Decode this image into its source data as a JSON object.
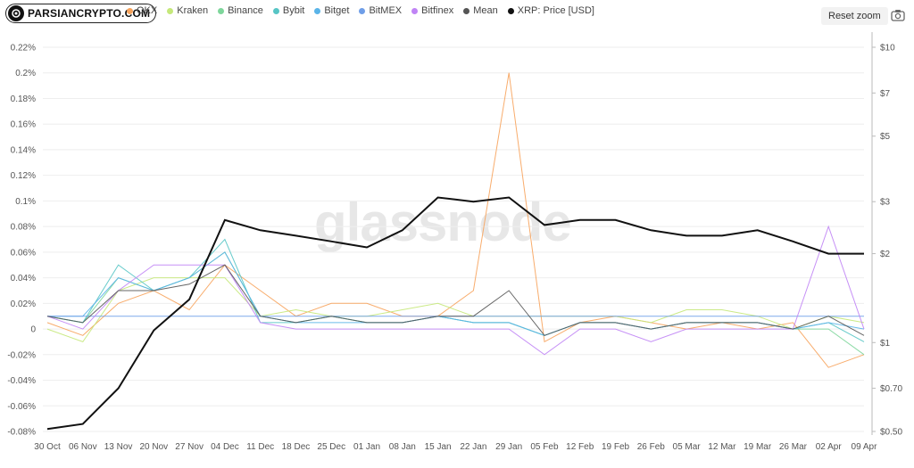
{
  "header": {
    "badge_text": "PARSIANCRYPTO.COM",
    "reset_zoom_label": "Reset zoom",
    "watermark": "glassnode"
  },
  "chart_data": {
    "type": "line",
    "left_axis": {
      "ticks": [
        "0.22%",
        "0.2%",
        "0.18%",
        "0.16%",
        "0.14%",
        "0.12%",
        "0.1%",
        "0.08%",
        "0.06%",
        "0.04%",
        "0.02%",
        "0",
        "-0.02%",
        "-0.04%",
        "-0.06%",
        "-0.08%"
      ],
      "range": [
        -0.08,
        0.22
      ],
      "unit": "%"
    },
    "right_axis": {
      "scale": "log",
      "ticks": [
        {
          "label": "$10",
          "value": 10
        },
        {
          "label": "$7",
          "value": 7
        },
        {
          "label": "$5",
          "value": 5
        },
        {
          "label": "$3",
          "value": 3
        },
        {
          "label": "$2",
          "value": 2
        },
        {
          "label": "$1",
          "value": 1
        },
        {
          "label": "$0.70",
          "value": 0.7
        },
        {
          "label": "$0.50",
          "value": 0.5
        }
      ],
      "range": [
        0.5,
        10
      ]
    },
    "x_labels": [
      "30 Oct",
      "06 Nov",
      "13 Nov",
      "20 Nov",
      "27 Nov",
      "04 Dec",
      "11 Dec",
      "18 Dec",
      "25 Dec",
      "01 Jan",
      "08 Jan",
      "15 Jan",
      "22 Jan",
      "29 Jan",
      "05 Feb",
      "12 Feb",
      "19 Feb",
      "26 Feb",
      "05 Mar",
      "12 Mar",
      "19 Mar",
      "26 Mar",
      "02 Apr",
      "09 Apr"
    ],
    "series": [
      {
        "name": "OKX",
        "color": "#f7a35c"
      },
      {
        "name": "Kraken",
        "color": "#c5e87a"
      },
      {
        "name": "Binance",
        "color": "#7ed69b"
      },
      {
        "name": "Bybit",
        "color": "#57c5c5"
      },
      {
        "name": "Bitget",
        "color": "#5ab4e8"
      },
      {
        "name": "BitMEX",
        "color": "#6f9ee8"
      },
      {
        "name": "Bitfinex",
        "color": "#c084f5"
      },
      {
        "name": "Mean",
        "color": "#555555"
      },
      {
        "name": "XRP: Price [USD]",
        "color": "#111111"
      }
    ],
    "price_series": {
      "name": "XRP: Price [USD]",
      "x": [
        "30 Oct",
        "06 Nov",
        "13 Nov",
        "20 Nov",
        "27 Nov",
        "04 Dec",
        "11 Dec",
        "18 Dec",
        "25 Dec",
        "01 Jan",
        "08 Jan",
        "15 Jan",
        "22 Jan",
        "29 Jan",
        "05 Feb",
        "12 Feb",
        "19 Feb",
        "26 Feb",
        "05 Mar",
        "12 Mar",
        "19 Mar",
        "26 Mar",
        "02 Apr",
        "09 Apr"
      ],
      "values": [
        0.51,
        0.53,
        0.7,
        1.1,
        1.4,
        2.6,
        2.4,
        2.3,
        2.2,
        2.1,
        2.4,
        3.1,
        3.0,
        3.1,
        2.5,
        2.6,
        2.6,
        2.4,
        2.3,
        2.3,
        2.4,
        2.2,
        2.0,
        2.0
      ]
    },
    "funding_series": [
      {
        "name": "OKX",
        "values": [
          0.005,
          -0.005,
          0.02,
          0.03,
          0.015,
          0.05,
          0.03,
          0.01,
          0.02,
          0.02,
          0.01,
          0.01,
          0.03,
          0.2,
          -0.01,
          0.005,
          0.01,
          0.005,
          0.0,
          0.005,
          0.0,
          0.005,
          -0.03,
          -0.02
        ]
      },
      {
        "name": "Kraken",
        "values": [
          0.0,
          -0.01,
          0.03,
          0.04,
          0.04,
          0.04,
          0.01,
          0.015,
          0.01,
          0.01,
          0.015,
          0.02,
          0.01,
          0.01,
          0.01,
          0.01,
          0.01,
          0.005,
          0.015,
          0.015,
          0.01,
          0.0,
          0.01,
          0.005
        ]
      },
      {
        "name": "Binance",
        "values": [
          0.01,
          0.005,
          0.04,
          0.03,
          0.04,
          0.06,
          0.01,
          0.005,
          0.01,
          0.005,
          0.005,
          0.01,
          0.005,
          0.005,
          -0.005,
          0.005,
          0.005,
          0.0,
          0.005,
          0.005,
          0.005,
          0.0,
          0.0,
          -0.02
        ]
      },
      {
        "name": "Bybit",
        "values": [
          0.01,
          0.005,
          0.05,
          0.03,
          0.04,
          0.07,
          0.005,
          0.005,
          0.01,
          0.005,
          0.005,
          0.01,
          0.005,
          0.005,
          -0.005,
          0.005,
          0.005,
          0.0,
          0.005,
          0.005,
          0.005,
          0.0,
          0.005,
          -0.01
        ]
      },
      {
        "name": "Bitget",
        "values": [
          0.01,
          0.01,
          0.04,
          0.03,
          0.04,
          0.06,
          0.01,
          0.005,
          0.005,
          0.005,
          0.005,
          0.01,
          0.005,
          0.005,
          -0.005,
          0.005,
          0.005,
          0.0,
          0.005,
          0.005,
          0.005,
          0.0,
          0.005,
          0.0
        ]
      },
      {
        "name": "BitMEX",
        "values": [
          0.01,
          0.01,
          0.01,
          0.01,
          0.01,
          0.01,
          0.01,
          0.01,
          0.01,
          0.01,
          0.01,
          0.01,
          0.01,
          0.01,
          0.01,
          0.01,
          0.01,
          0.01,
          0.01,
          0.01,
          0.01,
          0.01,
          0.01,
          0.01
        ]
      },
      {
        "name": "Bitfinex",
        "values": [
          0.01,
          0.0,
          0.03,
          0.05,
          0.05,
          0.05,
          0.005,
          0.0,
          0.0,
          0.0,
          0.0,
          0.0,
          0.0,
          0.0,
          -0.02,
          0.0,
          0.0,
          -0.01,
          0.0,
          0.0,
          0.0,
          0.0,
          0.08,
          0.0
        ]
      },
      {
        "name": "Mean",
        "values": [
          0.01,
          0.005,
          0.03,
          0.03,
          0.035,
          0.05,
          0.01,
          0.005,
          0.01,
          0.005,
          0.005,
          0.01,
          0.01,
          0.03,
          -0.005,
          0.005,
          0.005,
          0.0,
          0.005,
          0.005,
          0.005,
          0.0,
          0.01,
          -0.005
        ]
      }
    ]
  }
}
